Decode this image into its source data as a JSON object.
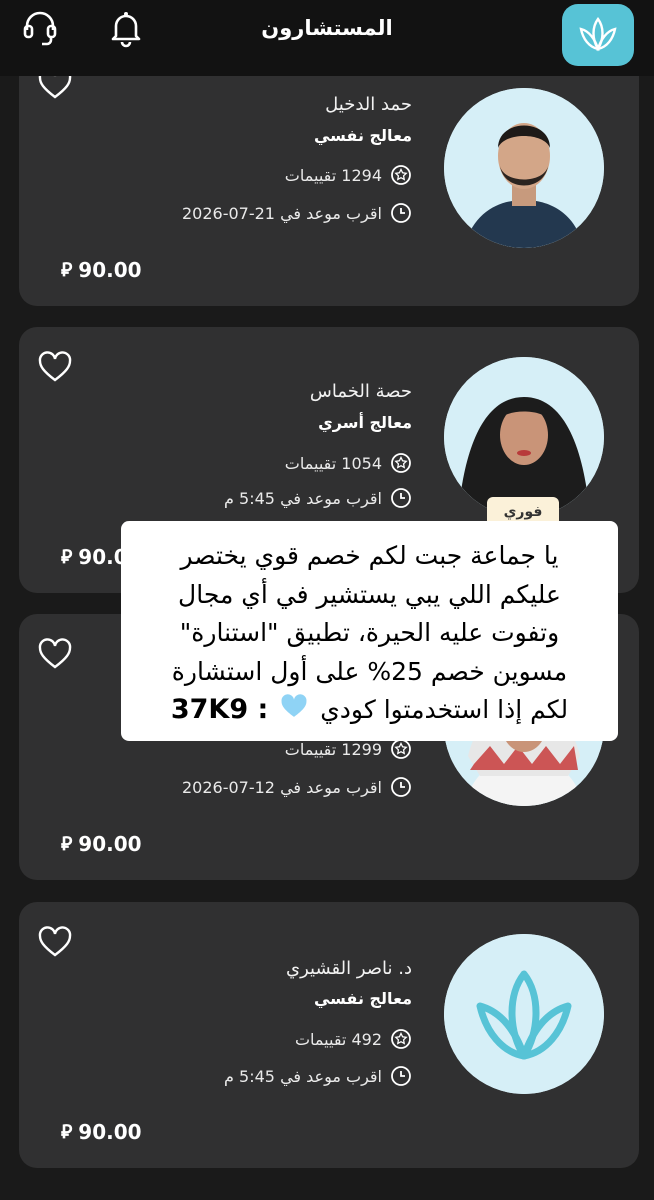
{
  "header": {
    "title": "المستشارون",
    "icons": [
      "headset-icon",
      "bell-icon",
      "lotus-logo"
    ]
  },
  "consultants": [
    {
      "name": "حمد الدخيل",
      "role": "معالج نفسي",
      "ratings": "1294 تقييمات",
      "next_slot": "اقرب موعد في 21-07-2026",
      "price": "90.00",
      "currency": "⃁",
      "avatar": "man-photo"
    },
    {
      "name": "حصة الخماس",
      "role": "معالج أسري",
      "ratings": "1054 تقييمات",
      "next_slot": "اقرب موعد في 5:45 م",
      "price": "90.00",
      "currency": "⃁",
      "badge": "فوري",
      "avatar": "woman-photo"
    },
    {
      "name": "",
      "role": "",
      "ratings": "1299 تقييمات",
      "next_slot": "اقرب موعد في 12-07-2026",
      "price": "90.00",
      "currency": "⃁",
      "avatar": "man-ghutra-photo"
    },
    {
      "name": "د. ناصر القشيري",
      "role": "معالج نفسي",
      "ratings": "492 تقييمات",
      "next_slot": "اقرب موعد في 5:45 م",
      "price": "90.00",
      "currency": "⃁",
      "avatar": "lotus-logo"
    }
  ],
  "promo": {
    "line1": "يا جماعة جبت لكم خصم قوي يختصر",
    "line2": "عليكم اللي يبي يستشير في أي مجال",
    "line3": "وتفوت عليه الحيرة، تطبيق \"استنارة\"",
    "line4": "مسوين خصم 25% على أول استشارة",
    "line5_prefix": "لكم إذا استخدمتوا كودي",
    "line5_code": ": 37K9",
    "emoji": "light-blue-heart"
  },
  "colors": {
    "background": "#1a1a1a",
    "card": "#303031",
    "brand": "#57c3d6",
    "avatar_bg": "#d6eff7"
  }
}
